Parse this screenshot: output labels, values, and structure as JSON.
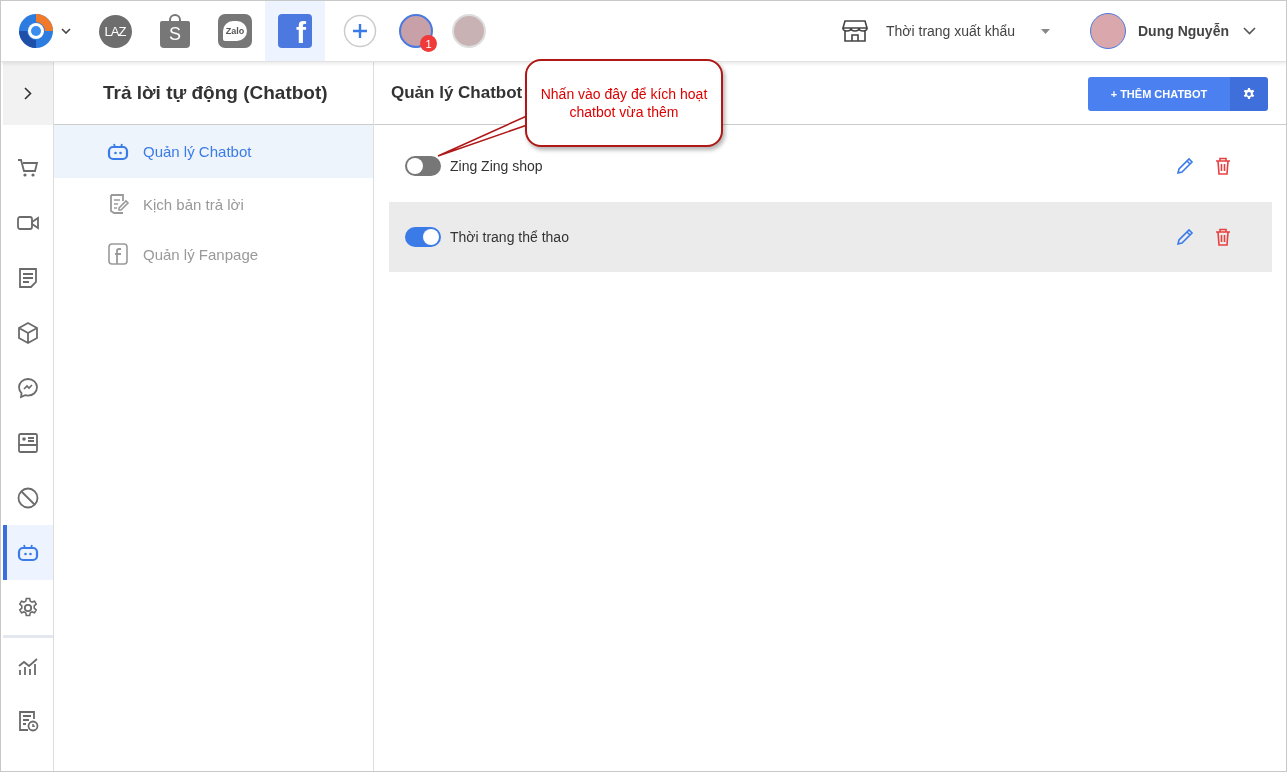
{
  "topbar": {
    "channels": [
      {
        "kind": "lazada",
        "label": "LAZ",
        "selected": false
      },
      {
        "kind": "shopee",
        "label": "S",
        "selected": false
      },
      {
        "kind": "zalo",
        "label": "Zalo",
        "selected": false
      },
      {
        "kind": "facebook",
        "label": "f",
        "selected": true
      }
    ],
    "accounts": [
      {
        "selected": true,
        "badge": "1"
      },
      {
        "selected": false
      }
    ],
    "shop": {
      "name": "Thời trang xuất khẩu"
    },
    "user": {
      "name": "Dung Nguyễn"
    }
  },
  "rail": {
    "groups": [
      {
        "items": [
          {
            "kind": "cart",
            "selected": false
          },
          {
            "kind": "video",
            "selected": false
          },
          {
            "kind": "document",
            "selected": false
          },
          {
            "kind": "box",
            "selected": false
          },
          {
            "kind": "messenger",
            "selected": false
          },
          {
            "kind": "card",
            "selected": false
          },
          {
            "kind": "block",
            "selected": false
          },
          {
            "kind": "bot",
            "selected": true
          },
          {
            "kind": "settings",
            "selected": false
          }
        ]
      },
      {
        "items": [
          {
            "kind": "chart",
            "selected": false
          },
          {
            "kind": "report",
            "selected": false
          }
        ]
      }
    ]
  },
  "submenu": {
    "title": "Trả lời tự động (Chatbot)",
    "items": [
      {
        "kind": "bot",
        "label": "Quản lý Chatbot",
        "selected": true
      },
      {
        "kind": "script",
        "label": "Kịch bản trả lời",
        "selected": false
      },
      {
        "kind": "facebook",
        "label": "Quản lý Fanpage",
        "selected": false
      }
    ]
  },
  "panel": {
    "title": "Quản lý Chatbot",
    "add_button": "+ THÊM CHATBOT",
    "chatbots": [
      {
        "name": "Zing Zing shop",
        "on": false,
        "selected": false
      },
      {
        "name": "Thời trang thể thao",
        "on": true,
        "selected": true
      }
    ]
  },
  "callout": {
    "text": "Nhấn vào đây để kích hoạt chatbot vừa thêm"
  }
}
